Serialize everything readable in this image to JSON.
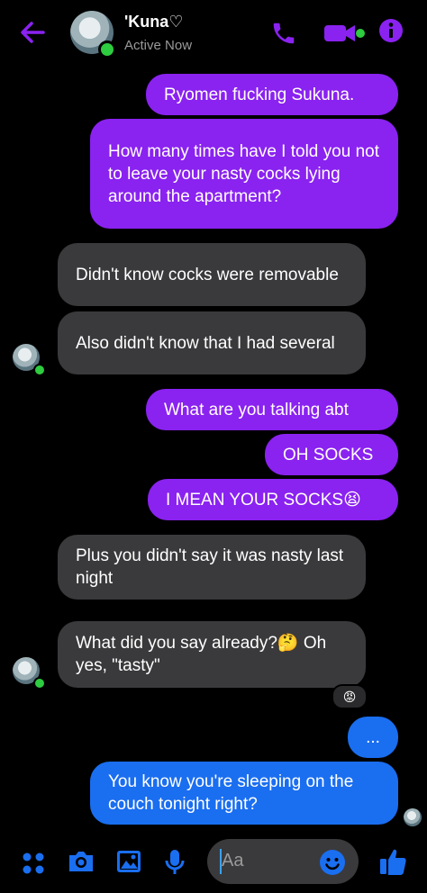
{
  "header": {
    "contact_name": "'Kuna♡",
    "status": "Active Now"
  },
  "messages": [
    "Ryomen fucking Sukuna.",
    "How many times have I told you not to leave your nasty cocks lying around the apartment?",
    "Didn't know cocks were removable",
    "Also didn't know that I had several",
    "What are you talking abt",
    "OH SOCKS",
    "I MEAN YOUR SOCKS😫",
    "Plus you didn't say it was nasty last night",
    "What did you say already?🤔 Oh yes, \"tasty\"",
    "...",
    "You know you're sleeping on the couch tonight right?"
  ],
  "reaction": "😡",
  "composer": {
    "placeholder": "Aa"
  },
  "colors": {
    "accent": "#8a22f0",
    "incoming": "#3a3a3c",
    "sending": "#1a6ef0",
    "online": "#2ecc40"
  }
}
